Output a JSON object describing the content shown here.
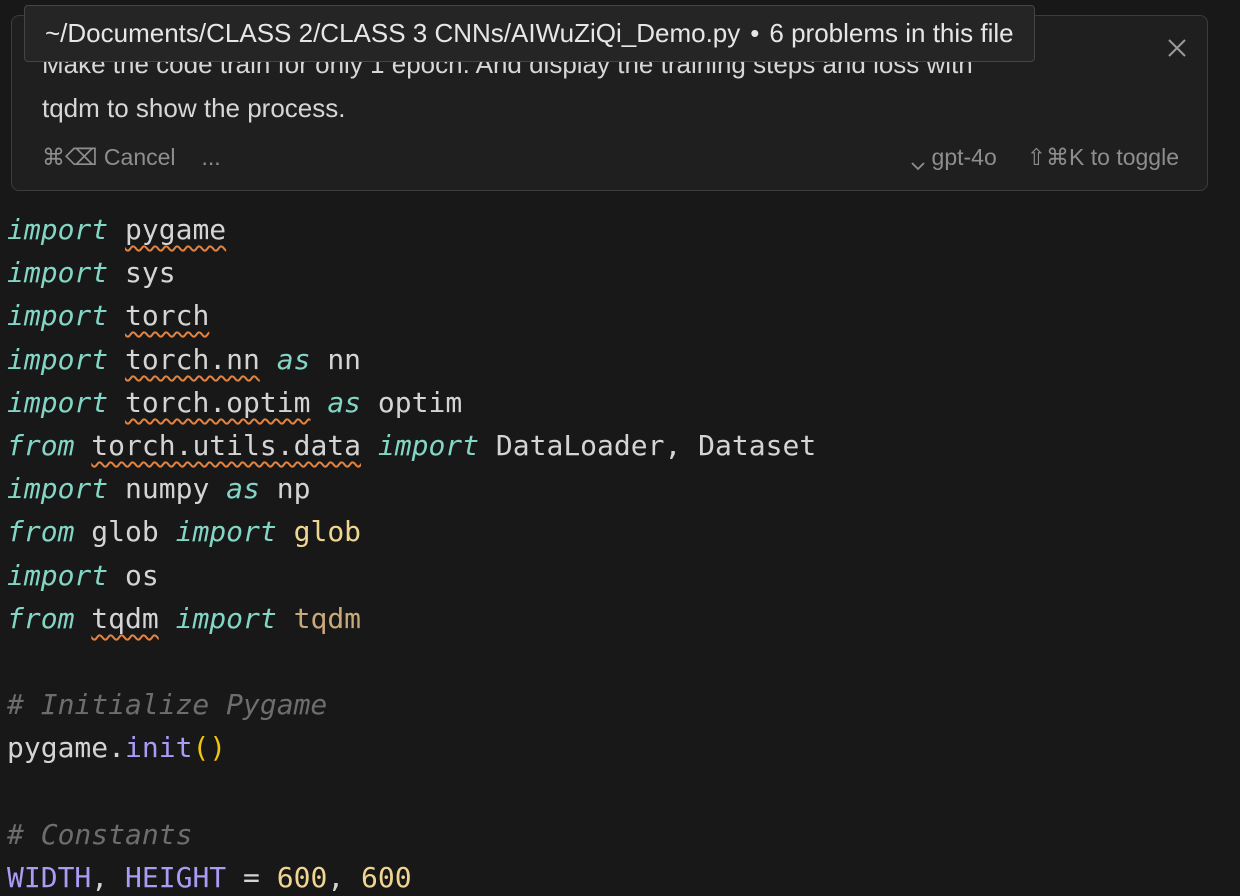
{
  "tooltip": {
    "path": "~/Documents/CLASS 2/CLASS 3 CNNs/AIWuZiQi_Demo.py",
    "separator": "•",
    "problems": "6 problems in this file"
  },
  "prompt": {
    "line1": "Make the code train for only 1 epoch. And display the training steps and loss with",
    "line2": "tqdm to show the process.",
    "cancel_label": "⌘⌫ Cancel",
    "more_label": "...",
    "model_label": "gpt-4o",
    "toggle_label": "⇧⌘K to toggle"
  },
  "code": {
    "l1": {
      "kw": "import",
      "mod": "pygame"
    },
    "l2": {
      "kw": "import",
      "mod": "sys"
    },
    "l3": {
      "kw": "import",
      "mod": "torch"
    },
    "l4": {
      "kw": "import",
      "mod": "torch.nn",
      "as": "as",
      "alias": "nn"
    },
    "l5": {
      "kw": "import",
      "mod": "torch.optim",
      "as": "as",
      "alias": "optim"
    },
    "l6": {
      "kw": "from",
      "mod": "torch.utils.data",
      "kw2": "import",
      "names": "DataLoader, Dataset"
    },
    "l7": {
      "kw": "import",
      "mod": "numpy",
      "as": "as",
      "alias": "np"
    },
    "l8": {
      "kw": "from",
      "mod": "glob",
      "kw2": "import",
      "name": "glob"
    },
    "l9": {
      "kw": "import",
      "mod": "os"
    },
    "l10": {
      "kw": "from",
      "mod": "tqdm",
      "kw2": "import",
      "name": "tqdm"
    },
    "l12": {
      "comment": "# Initialize Pygame"
    },
    "l13": {
      "obj": "pygame.",
      "call": "init",
      "paren": "()"
    },
    "l15": {
      "comment": "# Constants"
    },
    "l16": {
      "c1": "WIDTH",
      "comma": ", ",
      "c2": "HEIGHT",
      "eq": " = ",
      "n1": "600",
      "comma2": ", ",
      "n2": "600"
    }
  },
  "colors": {
    "background": "#181818",
    "keyword": "#83d6c5",
    "comment": "#6d6d6d",
    "warning_squiggle": "#e4833f",
    "constant": "#aa9bf5",
    "number": "#efd591"
  },
  "icons": {
    "close": "close-icon",
    "model_dropdown": "chevron-down-icon"
  }
}
